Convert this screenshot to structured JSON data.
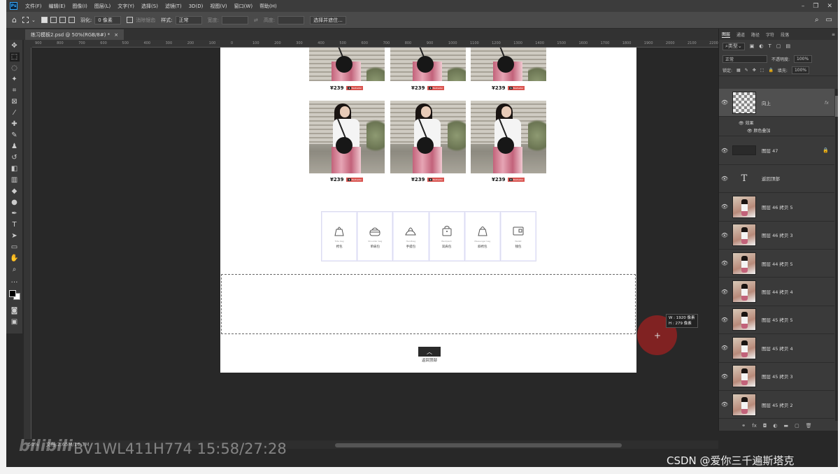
{
  "menubar": {
    "items": [
      "文件(F)",
      "编辑(E)",
      "图像(I)",
      "图层(L)",
      "文字(Y)",
      "选择(S)",
      "滤镜(T)",
      "3D(D)",
      "视图(V)",
      "窗口(W)",
      "帮助(H)"
    ],
    "logo": "Ps"
  },
  "options": {
    "feather_label": "羽化:",
    "feather_value": "0 像素",
    "antialias": "消除锯齿",
    "style_label": "样式:",
    "style_value": "正常",
    "width_label": "宽度:",
    "height_label": "高度:",
    "select_subject": "选择并遮住..."
  },
  "document": {
    "tab_title": "练习模板2.psd @ 50%(RGB/8#) *",
    "close": "×"
  },
  "ruler_ticks": [
    "900",
    "800",
    "700",
    "600",
    "500",
    "400",
    "300",
    "200",
    "100",
    "0",
    "100",
    "200",
    "300",
    "400",
    "500",
    "600",
    "700",
    "800",
    "900",
    "1000",
    "1100",
    "1200",
    "1300",
    "1400",
    "1500",
    "1600",
    "1700",
    "1800",
    "1900",
    "2000",
    "2100",
    "2200"
  ],
  "products": {
    "price": "¥239",
    "tag_prefix": "1",
    "tag_text": "Bestseller"
  },
  "categories": [
    {
      "en": "Tote bag",
      "cn": "挎包",
      "icon": "tote-bag-icon"
    },
    {
      "en": "Shoulder bag",
      "cn": "单肩包",
      "icon": "shoulder-bag-icon"
    },
    {
      "en": "Handbag",
      "cn": "手提包",
      "icon": "handbag-icon"
    },
    {
      "en": "Backpack",
      "cn": "双肩包",
      "icon": "backpack-icon"
    },
    {
      "en": "Messenger bag",
      "cn": "斜挎包",
      "icon": "messenger-bag-icon"
    },
    {
      "en": "Wallet",
      "cn": "钱包",
      "icon": "wallet-icon"
    }
  ],
  "back_to_top": {
    "label": "返回顶部",
    "arrow": "︿"
  },
  "dimensions": {
    "w_label": "W :",
    "w_value": "1920 像素",
    "h_label": "H :",
    "h_value": "279 像素"
  },
  "status": {
    "zoom": "50%",
    "doc_size": "文档:2.65M/16.7M"
  },
  "watermark": {
    "bilibili": "bilibili",
    "video": "BV1WL411H774 15:58/27:28",
    "csdn": "CSDN @爱你三千遍斯塔克"
  },
  "panel": {
    "tabs": [
      "图层",
      "通道",
      "路径",
      "字符",
      "段落"
    ],
    "filter_kind": "类型",
    "blend_mode": "正常",
    "opacity_label": "不透明度:",
    "opacity_value": "100%",
    "lock_label": "锁定:",
    "fill_label": "填充:",
    "fill_value": "100%",
    "layers": [
      {
        "name": "向上",
        "thumb": "checker",
        "fx": "fx",
        "selected": true
      },
      {
        "name": "图层 47",
        "thumb": "dark",
        "lock": true
      },
      {
        "name": "返回顶部",
        "thumb": "text"
      },
      {
        "name": "图层 46 拷贝 5",
        "thumb": "figure"
      },
      {
        "name": "图层 46 拷贝 3",
        "thumb": "figure"
      },
      {
        "name": "图层 44 拷贝 5",
        "thumb": "figure"
      },
      {
        "name": "图层 44 拷贝 4",
        "thumb": "figure"
      },
      {
        "name": "图层 45 拷贝 5",
        "thumb": "figure"
      },
      {
        "name": "图层 45 拷贝 4",
        "thumb": "figure"
      },
      {
        "name": "图层 45 拷贝 3",
        "thumb": "figure"
      },
      {
        "name": "图层 45 拷贝 2",
        "thumb": "figure"
      }
    ],
    "effects_label": "效果",
    "effect_item": "颜色叠加"
  }
}
